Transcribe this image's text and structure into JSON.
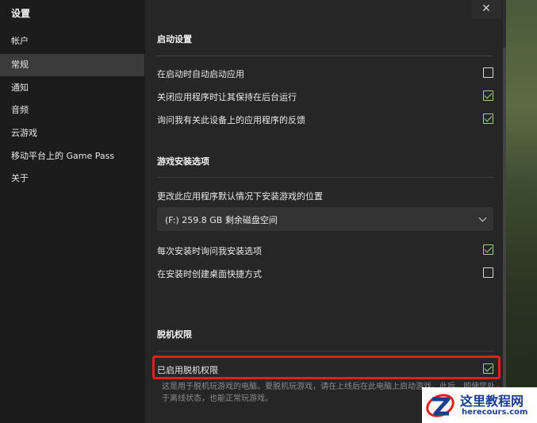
{
  "sidebar": {
    "title": "设置",
    "items": [
      {
        "label": "帐户"
      },
      {
        "label": "常规",
        "active": true
      },
      {
        "label": "通知"
      },
      {
        "label": "音频"
      },
      {
        "label": "云游戏"
      },
      {
        "label": "移动平台上的 Game Pass"
      },
      {
        "label": "关于"
      }
    ]
  },
  "close_button": {
    "glyph": "✕"
  },
  "sections": {
    "startup": {
      "title": "启动设置",
      "options": [
        {
          "label": "在启动时自动启动应用",
          "checked": false
        },
        {
          "label": "关闭应用程序时让其保持在后台运行",
          "checked": true
        },
        {
          "label": "询问我有关此设备上的应用程序的反馈",
          "checked": true
        }
      ]
    },
    "install": {
      "title": "游戏安装选项",
      "location_label": "更改此应用程序默认情况下安装游戏的位置",
      "drive_select_value": "(F:) 259.8 GB 剩余磁盘空间",
      "options": [
        {
          "label": "每次安装时询问我安装选项",
          "checked": true
        },
        {
          "label": "在安装时创建桌面快捷方式",
          "checked": false
        }
      ]
    },
    "offline": {
      "title": "脱机权限",
      "option": {
        "label": "已启用脱机权限",
        "checked": true
      },
      "description": "这是用于脱机玩游戏的电脑。要脱机玩游戏，请在上线后在此电脑上启动游戏。此后，即使您处于离线状态，也能正常玩游戏。"
    }
  },
  "watermark": {
    "title": "这里教程网",
    "url": "herecours.com"
  },
  "colors": {
    "highlight": "#e0201b",
    "check": "#9fd38a",
    "watermark": "#1b3e8f"
  }
}
